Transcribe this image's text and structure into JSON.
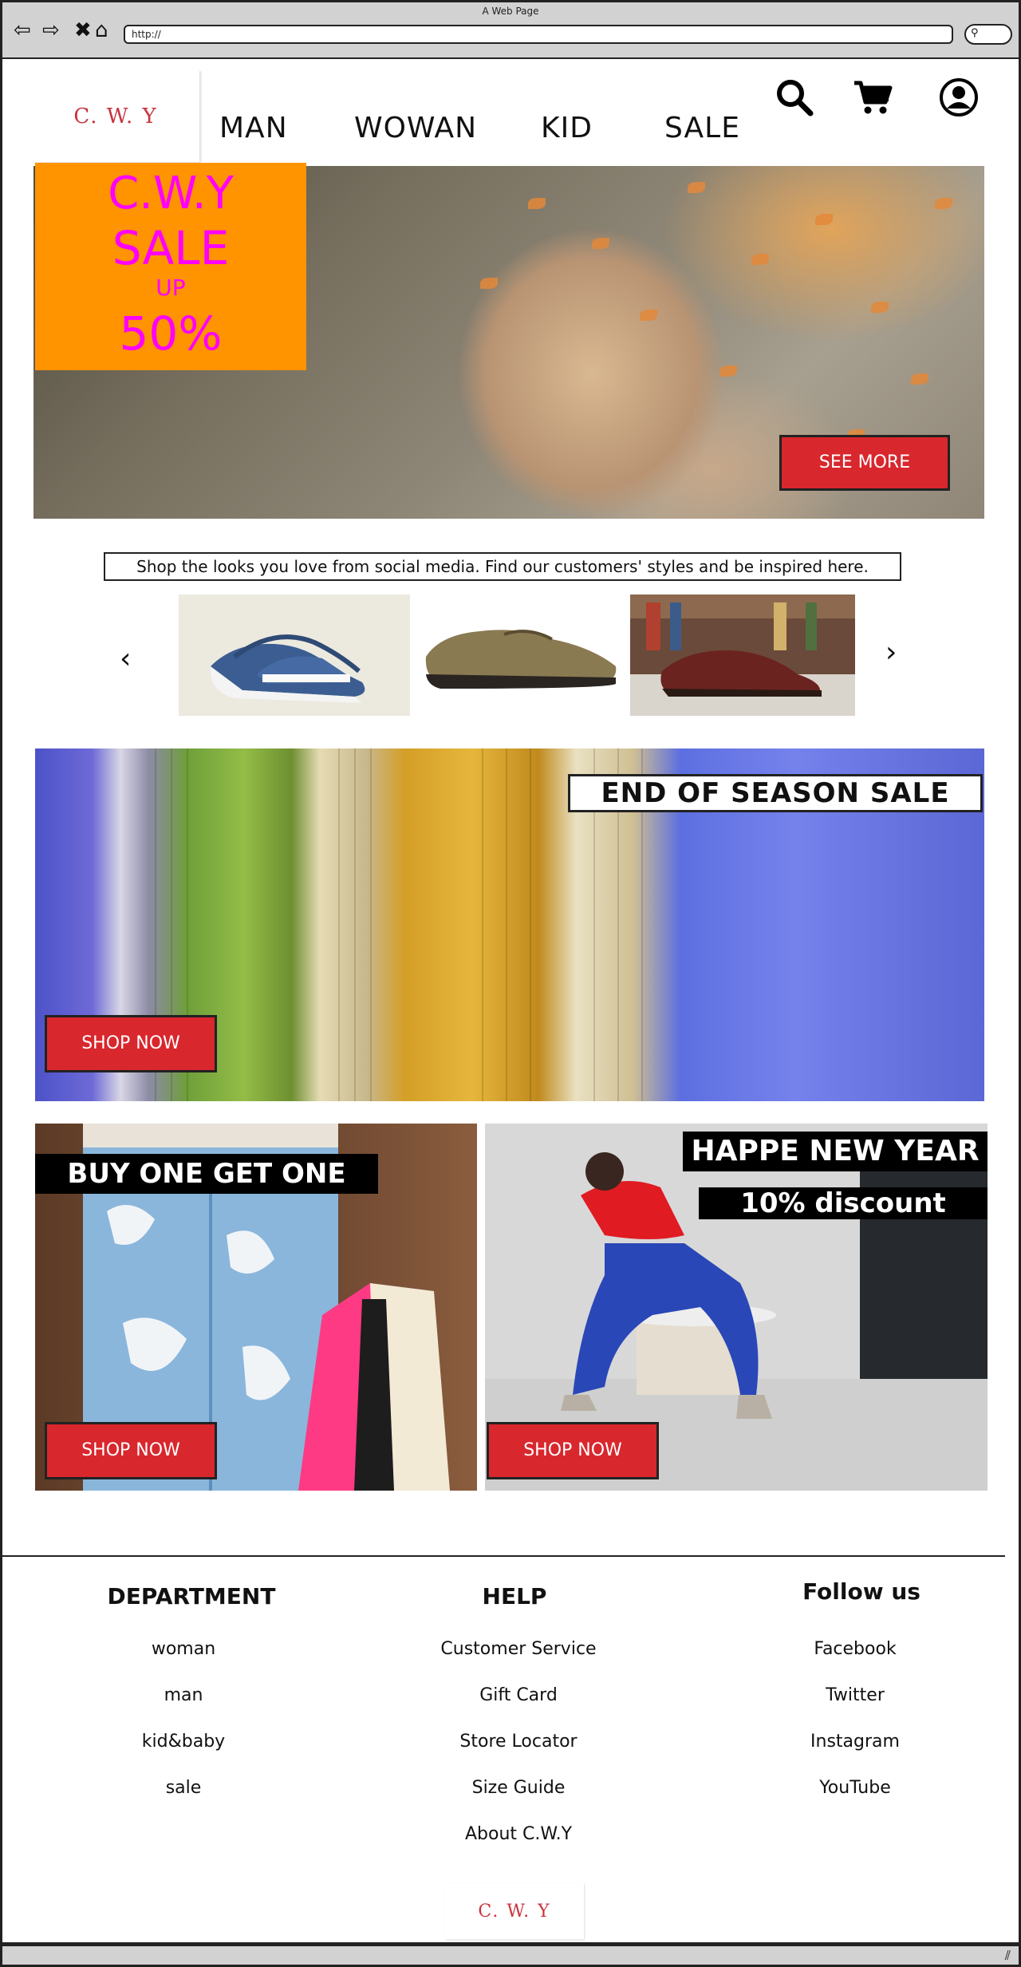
{
  "browser": {
    "title": "A Web Page",
    "url": "http://",
    "back_icon": "arrow-left-icon",
    "forward_icon": "arrow-right-icon",
    "stop_icon": "close-icon",
    "home_icon": "home-icon"
  },
  "header": {
    "logo": "C. W. Y",
    "nav": [
      "MAN",
      "WOWAN",
      "KID",
      "SALE"
    ],
    "icons": [
      "search-icon",
      "cart-icon",
      "user-icon"
    ]
  },
  "hero": {
    "sale_lines": [
      "C.W.Y",
      "SALE",
      "UP",
      "50%"
    ],
    "cta": "SEE MORE"
  },
  "social": {
    "caption": "Shop the looks you love from social media. Find our customers' styles and be inspired here.",
    "prev": "‹",
    "next": "›"
  },
  "season": {
    "title": "END OF SEASON SALE",
    "cta": "SHOP NOW"
  },
  "promo_left": {
    "title": "BUY ONE GET ONE",
    "cta": "SHOP NOW"
  },
  "promo_right": {
    "title": "HAPPE NEW YEAR",
    "subtitle": "10% discount",
    "cta": "SHOP NOW"
  },
  "footer": {
    "department": {
      "title": "DEPARTMENT",
      "links": [
        "woman",
        "man",
        "kid&baby",
        "sale"
      ]
    },
    "help": {
      "title": "HELP",
      "links": [
        "Customer Service",
        "Gift Card",
        "Store Locator",
        "Size Guide",
        "About C.W.Y"
      ]
    },
    "follow": {
      "title": "Follow us",
      "links": [
        "Facebook",
        "Twitter",
        "Instagram",
        "YouTube"
      ]
    },
    "logo": "C. W. Y"
  },
  "colors": {
    "accent_red": "#d8272d",
    "sale_orange": "#ff9300",
    "sale_magenta": "#ff00ff",
    "logo_red": "#c9333d"
  }
}
